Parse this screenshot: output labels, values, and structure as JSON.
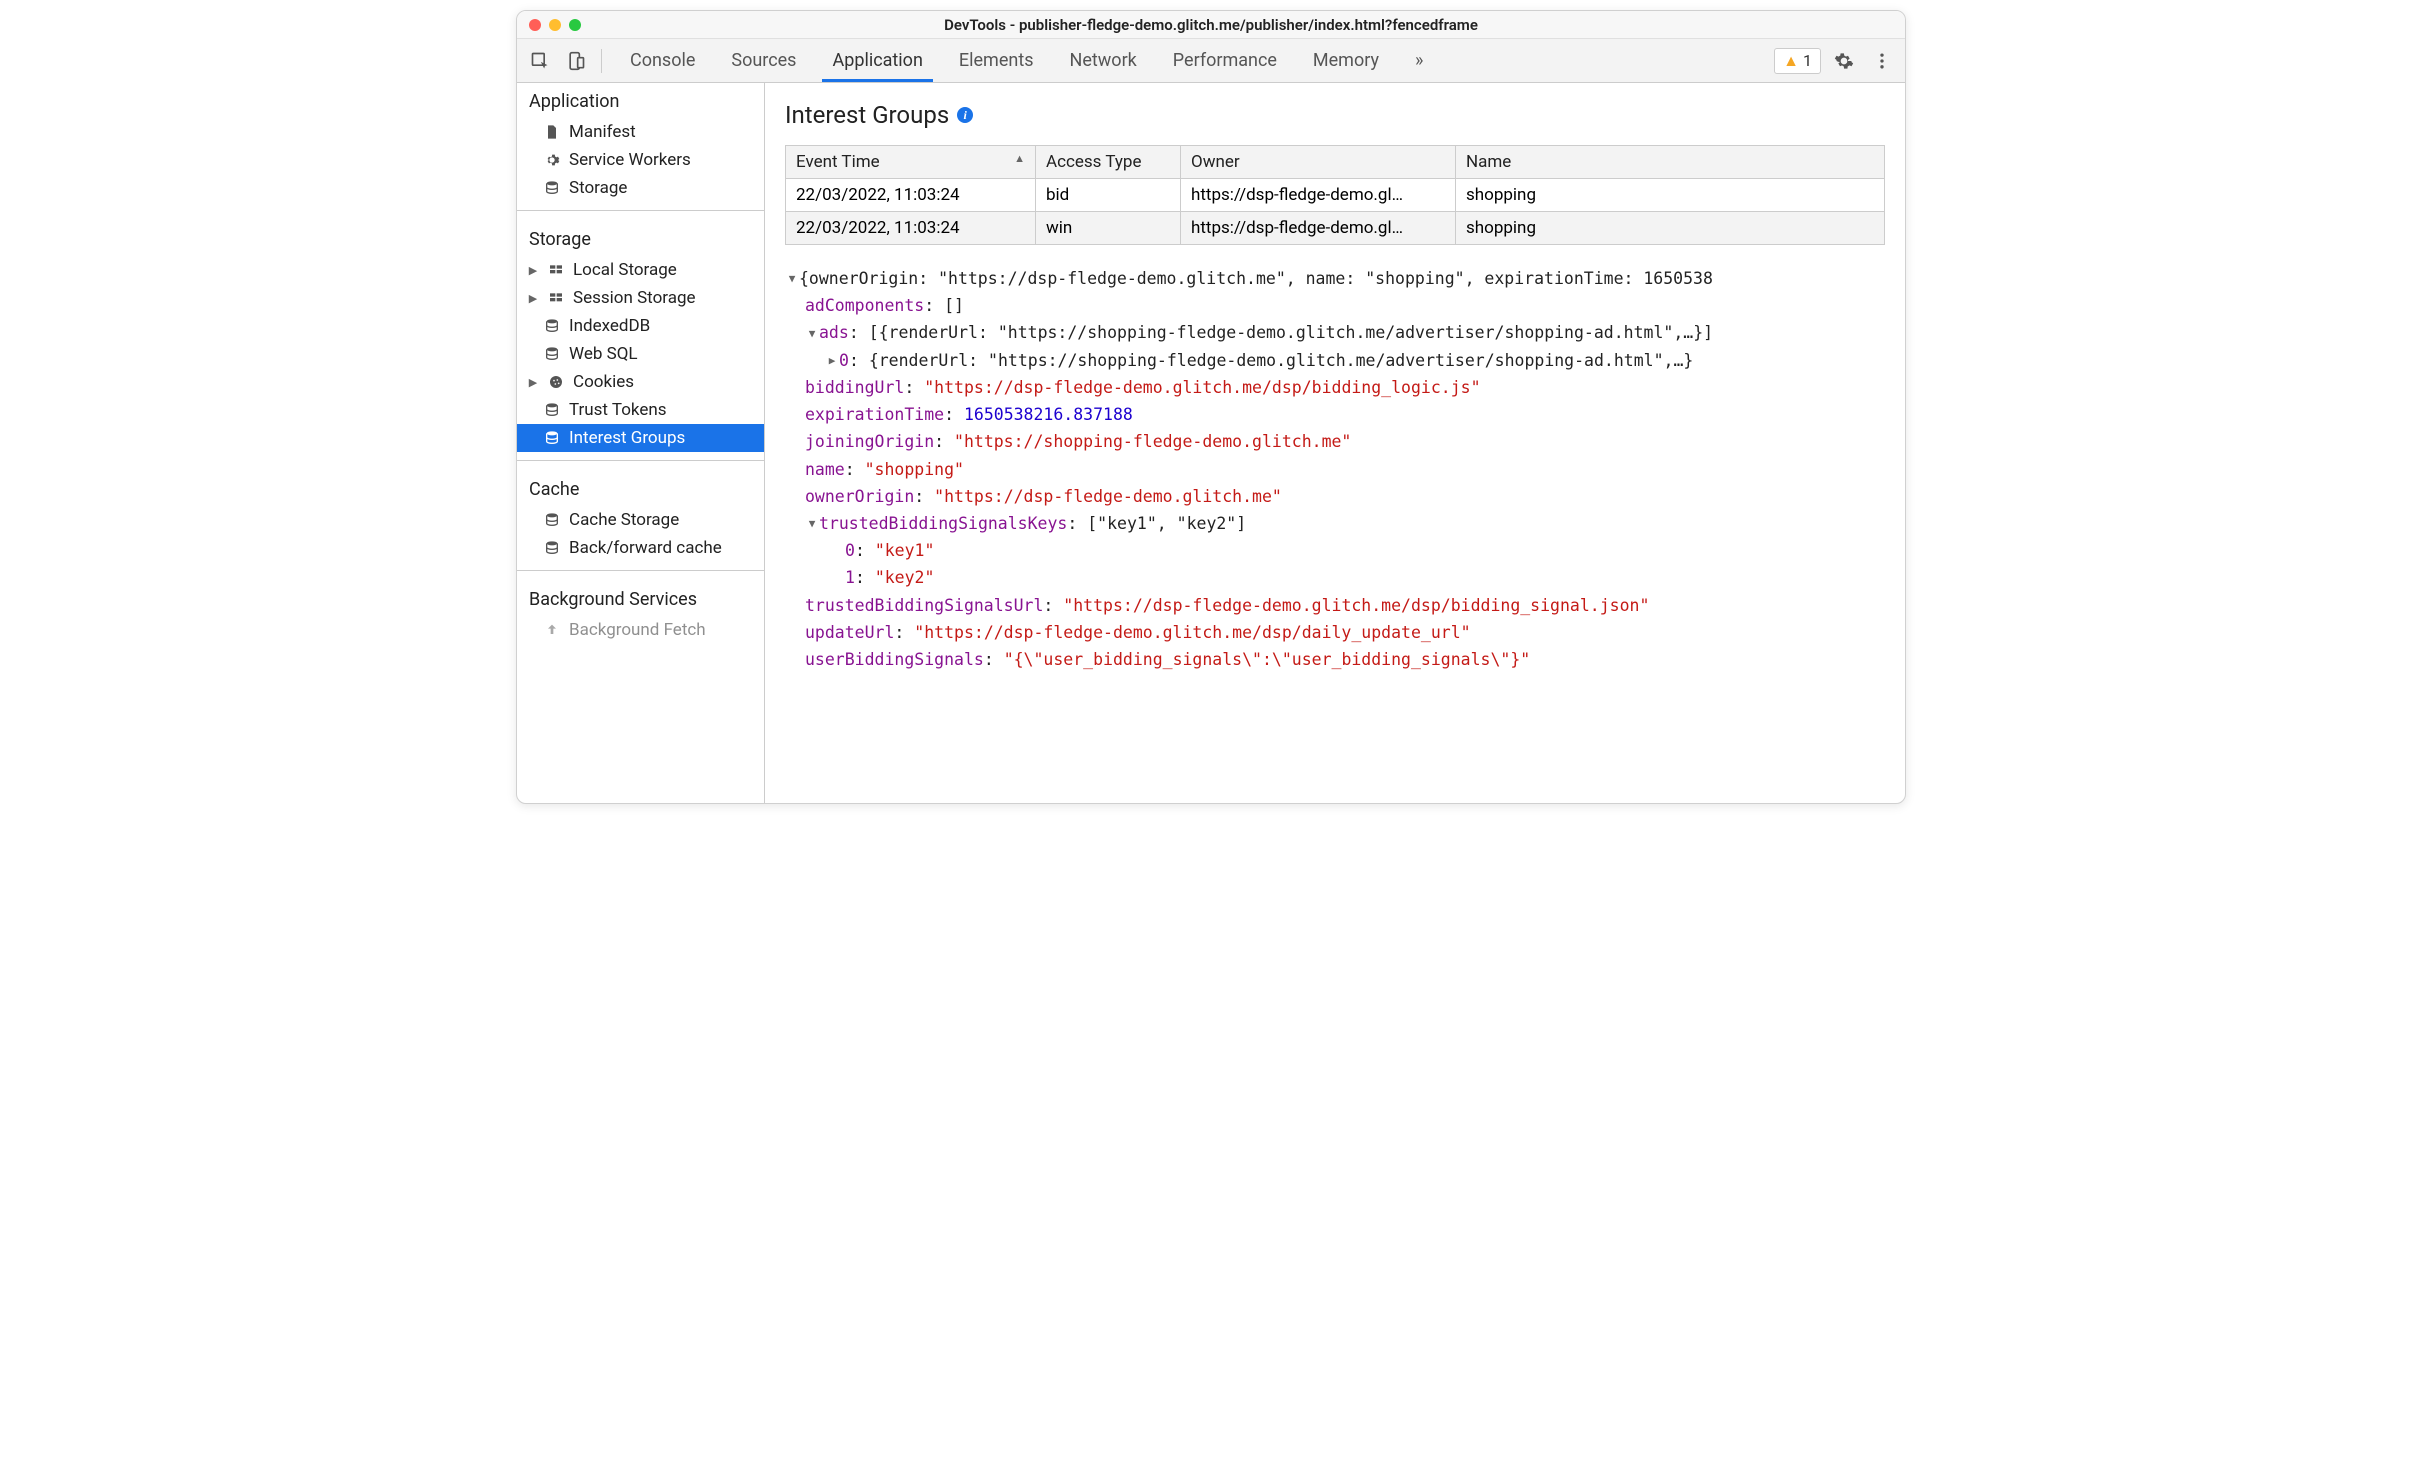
{
  "window": {
    "title": "DevTools - publisher-fledge-demo.glitch.me/publisher/index.html?fencedframe"
  },
  "toolbar": {
    "tabs": [
      "Console",
      "Sources",
      "Application",
      "Elements",
      "Network",
      "Performance",
      "Memory"
    ],
    "active_tab": "Application",
    "warning_count": "1"
  },
  "sidebar": {
    "application": {
      "title": "Application",
      "items": [
        {
          "label": "Manifest",
          "icon": "file-icon"
        },
        {
          "label": "Service Workers",
          "icon": "gear-icon"
        },
        {
          "label": "Storage",
          "icon": "database-icon"
        }
      ]
    },
    "storage": {
      "title": "Storage",
      "items": [
        {
          "label": "Local Storage",
          "icon": "table-icon",
          "expandable": true
        },
        {
          "label": "Session Storage",
          "icon": "table-icon",
          "expandable": true
        },
        {
          "label": "IndexedDB",
          "icon": "database-icon"
        },
        {
          "label": "Web SQL",
          "icon": "database-icon"
        },
        {
          "label": "Cookies",
          "icon": "cookie-icon",
          "expandable": true
        },
        {
          "label": "Trust Tokens",
          "icon": "database-icon"
        },
        {
          "label": "Interest Groups",
          "icon": "database-icon",
          "selected": true
        }
      ]
    },
    "cache": {
      "title": "Cache",
      "items": [
        {
          "label": "Cache Storage",
          "icon": "database-icon"
        },
        {
          "label": "Back/forward cache",
          "icon": "database-icon"
        }
      ]
    },
    "background": {
      "title": "Background Services",
      "items": [
        {
          "label": "Background Fetch",
          "icon": "arrow-up-icon"
        }
      ]
    }
  },
  "panel": {
    "heading": "Interest Groups",
    "columns": {
      "event_time": "Event Time",
      "access_type": "Access Type",
      "owner": "Owner",
      "name": "Name"
    },
    "rows": [
      {
        "event_time": "22/03/2022, 11:03:24",
        "access_type": "bid",
        "owner": "https://dsp-fledge-demo.gl…",
        "name": "shopping"
      },
      {
        "event_time": "22/03/2022, 11:03:24",
        "access_type": "win",
        "owner": "https://dsp-fledge-demo.gl…",
        "name": "shopping"
      }
    ]
  },
  "detail": {
    "summary": "{ownerOrigin: \"https://dsp-fledge-demo.glitch.me\", name: \"shopping\", expirationTime: 1650538",
    "adComponents": "[]",
    "ads_summary": "[{renderUrl: \"https://shopping-fledge-demo.glitch.me/advertiser/shopping-ad.html\",…}]",
    "ads_0": "{renderUrl: \"https://shopping-fledge-demo.glitch.me/advertiser/shopping-ad.html\",…}",
    "biddingUrl": "\"https://dsp-fledge-demo.glitch.me/dsp/bidding_logic.js\"",
    "expirationTime": "1650538216.837188",
    "joiningOrigin": "\"https://shopping-fledge-demo.glitch.me\"",
    "name": "\"shopping\"",
    "ownerOrigin": "\"https://dsp-fledge-demo.glitch.me\"",
    "trustedBiddingSignalsKeys_summary": "[\"key1\", \"key2\"]",
    "tbsk_0": "\"key1\"",
    "tbsk_1": "\"key2\"",
    "trustedBiddingSignalsUrl": "\"https://dsp-fledge-demo.glitch.me/dsp/bidding_signal.json\"",
    "updateUrl": "\"https://dsp-fledge-demo.glitch.me/dsp/daily_update_url\"",
    "userBiddingSignals": "\"{\\\"user_bidding_signals\\\":\\\"user_bidding_signals\\\"}\"",
    "labels": {
      "adComponents": "adComponents",
      "ads": "ads",
      "ads_index": "0",
      "biddingUrl": "biddingUrl",
      "expirationTime": "expirationTime",
      "joiningOrigin": "joiningOrigin",
      "name": "name",
      "ownerOrigin": "ownerOrigin",
      "trustedBiddingSignalsKeys": "trustedBiddingSignalsKeys",
      "tbsk_index0": "0",
      "tbsk_index1": "1",
      "trustedBiddingSignalsUrl": "trustedBiddingSignalsUrl",
      "updateUrl": "updateUrl",
      "userBiddingSignals": "userBiddingSignals"
    }
  }
}
